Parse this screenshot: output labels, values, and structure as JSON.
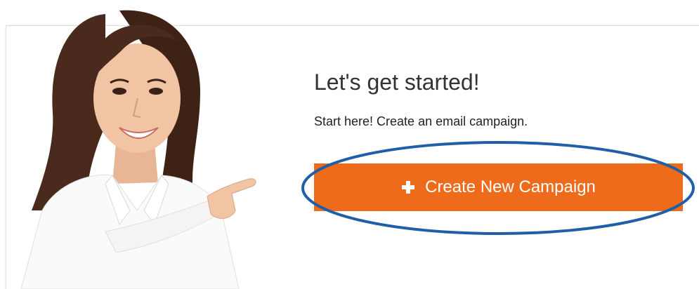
{
  "onboarding": {
    "heading": "Let's get started!",
    "subtext": "Start here! Create an email campaign.",
    "create_button_label": "Create New Campaign",
    "create_button_icon": "plus-icon"
  },
  "colors": {
    "button_bg": "#ef6b1c",
    "highlight_ring": "#1f5fa8",
    "heading_text": "#333333"
  },
  "illustration": {
    "description_icon": "woman-pointing-image"
  }
}
